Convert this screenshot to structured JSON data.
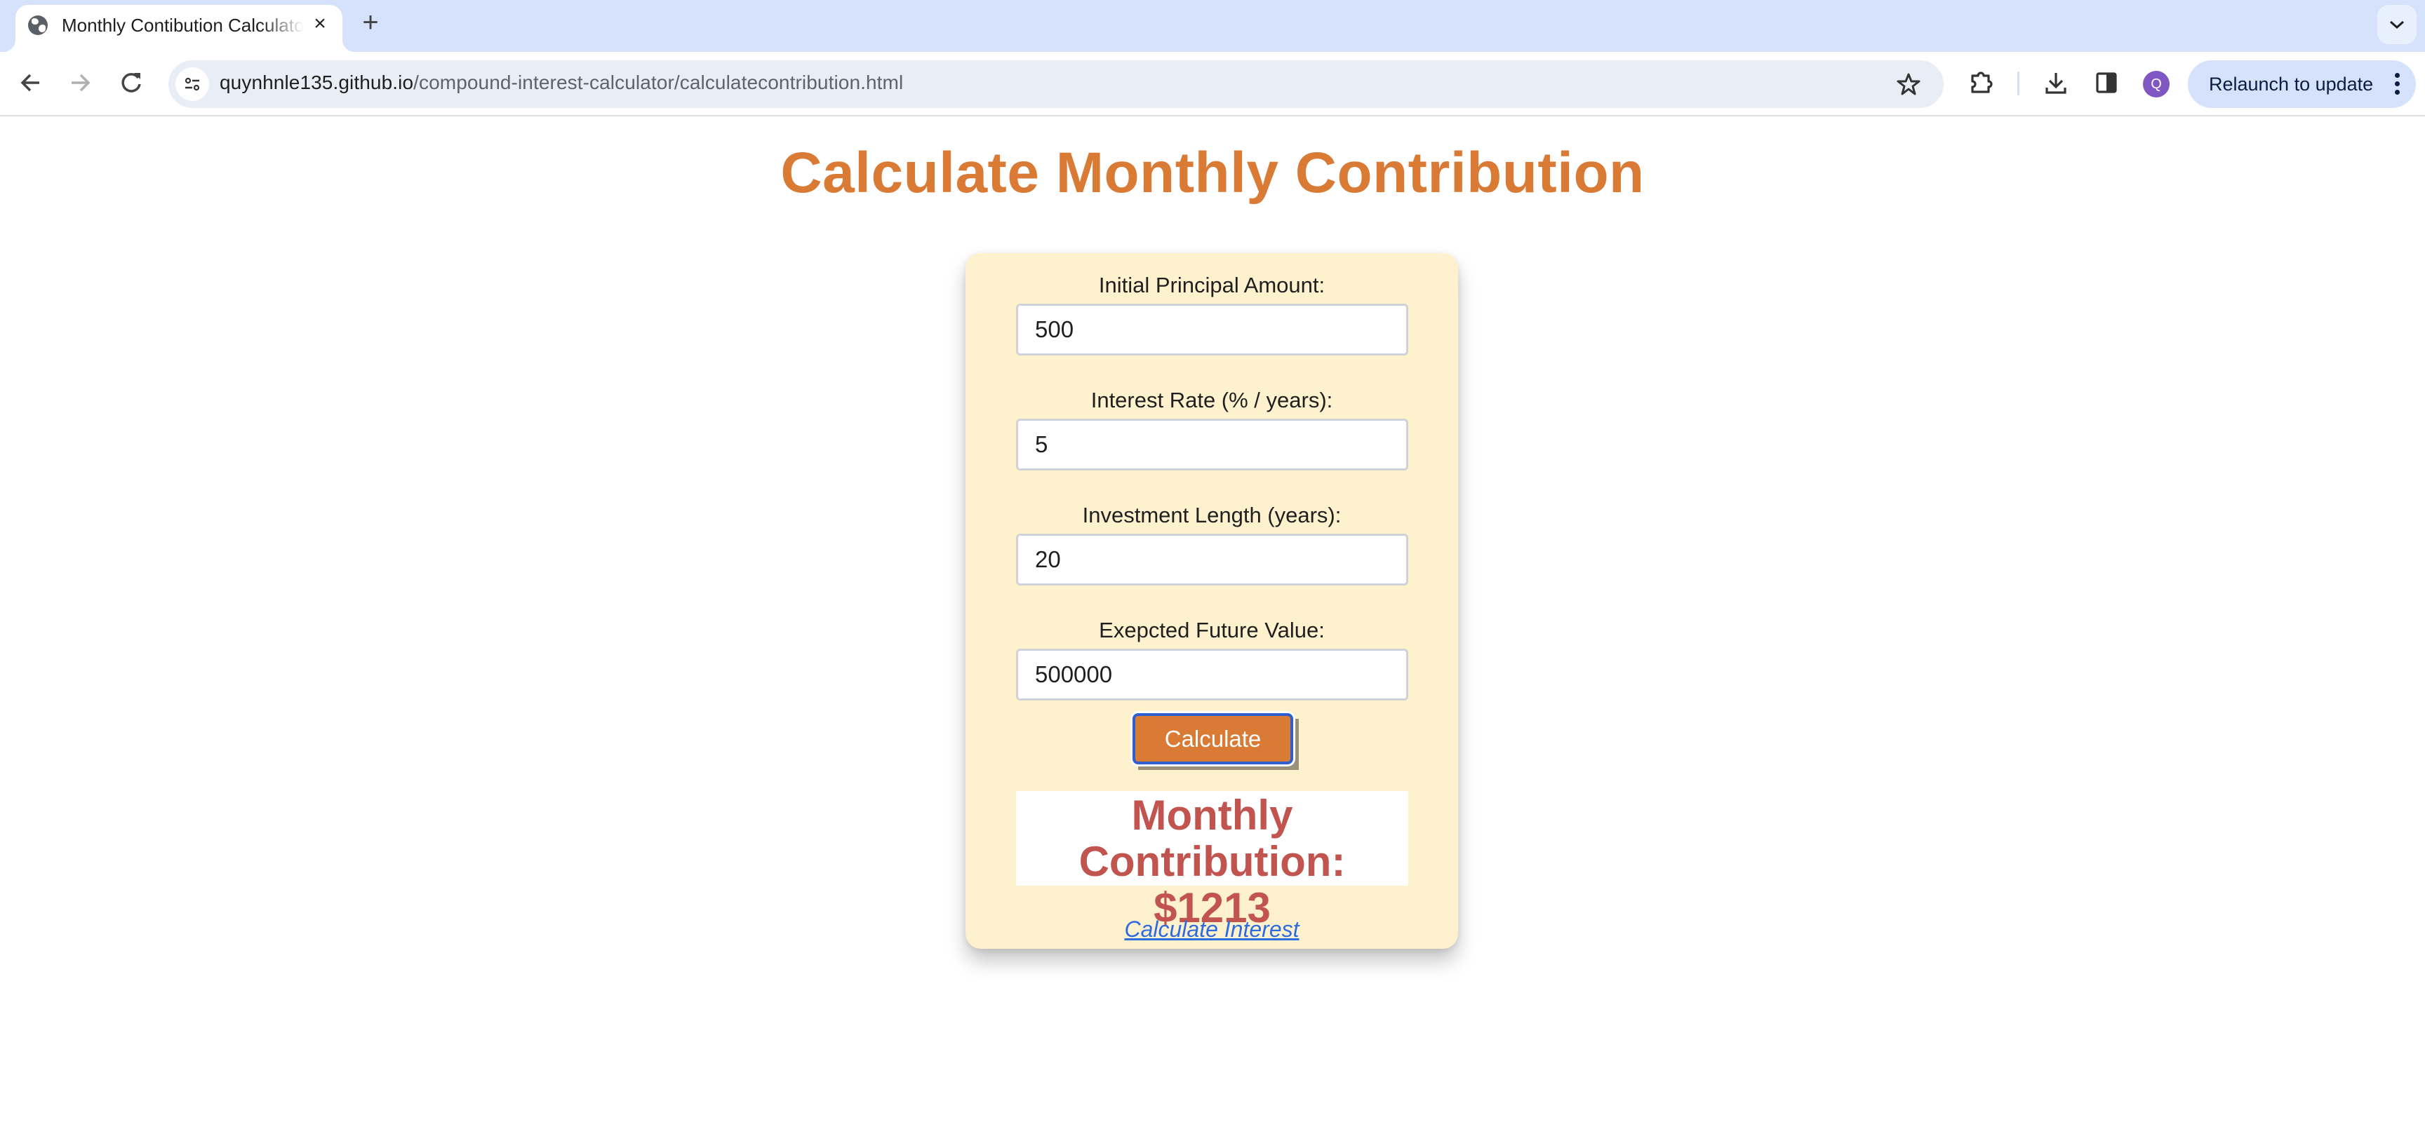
{
  "browser": {
    "tab": {
      "title": "Monthly Contibution Calculator",
      "favicon": "globe-icon",
      "close_icon": "close-icon"
    },
    "new_tab_icon": "plus-icon",
    "tab_search_icon": "chevron-down-icon",
    "nav": {
      "back_icon": "arrow-left-icon",
      "forward_icon": "arrow-right-icon",
      "reload_icon": "reload-icon"
    },
    "omnibox": {
      "site_info_icon": "tune-icon",
      "url_host": "quynhnle135.github.io",
      "url_path": "/compound-interest-calculator/calculatecontribution.html",
      "bookmark_icon": "star-icon"
    },
    "toolbar_icons": [
      "puzzle-icon",
      "download-icon",
      "sidebar-icon"
    ],
    "profile_initial": "Q",
    "relaunch_label": "Relaunch to update",
    "menu_icon": "kebab-menu-icon"
  },
  "page": {
    "title": "Calculate Monthly Contribution",
    "form": {
      "fields": [
        {
          "label": "Initial Principal Amount:",
          "value": "500"
        },
        {
          "label": "Interest Rate (% / years):",
          "value": "5"
        },
        {
          "label": "Investment Length (years):",
          "value": "20"
        },
        {
          "label": "Exepcted Future Value:",
          "value": "500000"
        }
      ],
      "submit_label": "Calculate"
    },
    "result": {
      "line1": "Monthly",
      "line2": "Contribution: $1213"
    },
    "link_label": "Calculate Interest"
  },
  "colors": {
    "accent": "#d97a35",
    "card_background": "#fdf2cd",
    "result_text": "#c25450",
    "link": "#2f6be0",
    "focus_ring": "#2f5fcf"
  }
}
